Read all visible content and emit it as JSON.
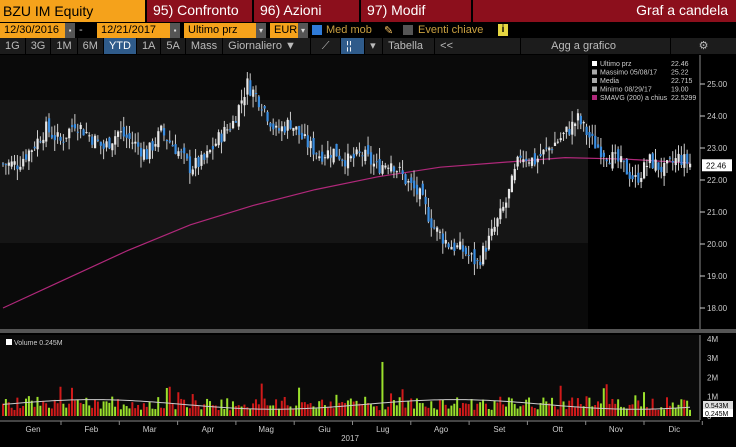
{
  "header": {
    "ticker": "BZU IM Equity",
    "confronto": "95) Confronto",
    "azioni": "96) Azioni",
    "modif": "97) Modif",
    "title": "Graf a candela"
  },
  "controls": {
    "start_date": "12/30/2016",
    "dash": "-",
    "end_date": "12/21/2017",
    "field": "Ultimo prz",
    "currency": "EUR",
    "moving_avg": "Med mob",
    "key_events": "Eventi chiave",
    "info": "i"
  },
  "toolbar": {
    "periods": [
      "1G",
      "3G",
      "1M",
      "6M",
      "YTD",
      "1A",
      "5A",
      "Mass"
    ],
    "active": "YTD",
    "frequency": "Giornaliero ▼",
    "table": "Tabella",
    "back": "<<",
    "add": "Agg a grafico",
    "settings": "⚙"
  },
  "chart_data": {
    "type": "candlestick",
    "legend": [
      {
        "label": "Ultimo prz",
        "value": "22.46"
      },
      {
        "label": "Massimo 05/08/17",
        "value": "25.22"
      },
      {
        "label": "Media",
        "value": "22.715"
      },
      {
        "label": "Minimo 08/29/17",
        "value": "19.00"
      },
      {
        "label": "SMAVG (200) a chius",
        "value": "22.5299"
      }
    ],
    "ylim": [
      17.5,
      25.8
    ],
    "yticks": [
      "25.00",
      "24.00",
      "23.00",
      "22.00",
      "21.00",
      "20.00",
      "19.00",
      "18.00"
    ],
    "last_price_tag": "22.46",
    "weekly_close": [
      22.5,
      23.0,
      23.6,
      23.2,
      23.8,
      23.4,
      23.0,
      23.5,
      23.2,
      22.8,
      23.5,
      23.0,
      22.4,
      22.6,
      23.3,
      23.8,
      25.0,
      24.4,
      23.5,
      23.8,
      23.2,
      22.8,
      22.9,
      22.6,
      22.8,
      22.4,
      22.6,
      22.0,
      21.5,
      20.5,
      20.0,
      19.8,
      19.4,
      20.3,
      21.3,
      22.8,
      22.6,
      23.0,
      23.4,
      23.9,
      23.2,
      22.8,
      22.5,
      22.0,
      22.6,
      22.3,
      22.7,
      22.46
    ],
    "sma200_monthly": [
      18.0,
      18.9,
      19.8,
      20.6,
      21.2,
      21.7,
      22.1,
      22.4,
      22.55,
      22.7,
      22.65,
      22.53
    ],
    "volume": {
      "legend": "Volume 0.245M",
      "yticks": [
        "4M",
        "3M",
        "2M",
        "1M",
        "0"
      ],
      "tags": [
        "0.543M",
        "0.245M"
      ]
    },
    "xticks": [
      "Gen",
      "Feb",
      "Mar",
      "Apr",
      "Mag",
      "Giu",
      "Lug",
      "Ago",
      "Set",
      "Ott",
      "Nov",
      "Dic"
    ],
    "xlabel": "2017"
  }
}
